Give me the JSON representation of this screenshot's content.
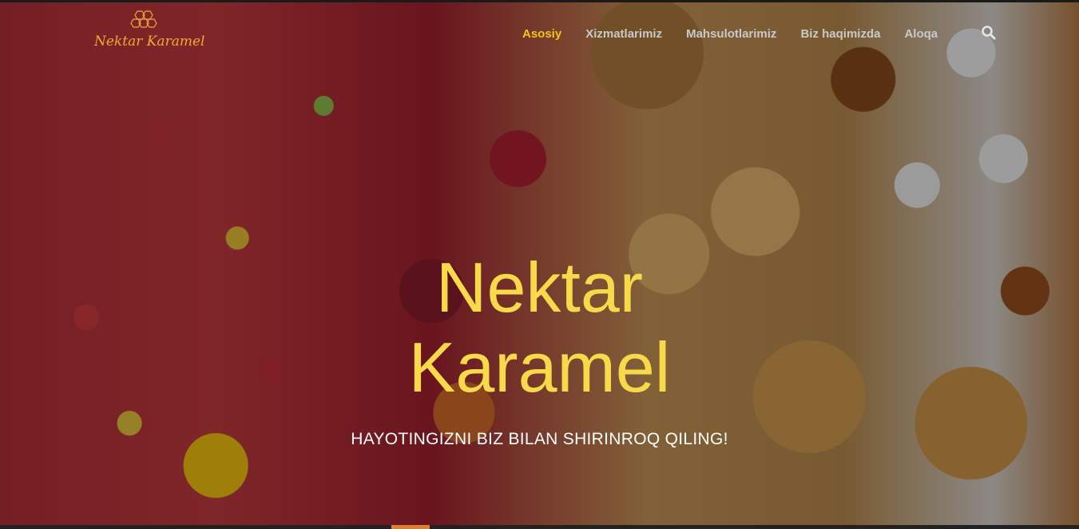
{
  "brand": {
    "name": "Nektar Karamel"
  },
  "nav": {
    "items": [
      {
        "label": "Asosiy",
        "active": true
      },
      {
        "label": "Xizmatlarimiz",
        "active": false
      },
      {
        "label": "Mahsulotlarimiz",
        "active": false
      },
      {
        "label": "Biz haqimizda",
        "active": false
      },
      {
        "label": "Aloqa",
        "active": false
      }
    ],
    "search_icon": "search-icon"
  },
  "hero": {
    "title_line1": "Nektar",
    "title_line2": "Karamel",
    "tagline": "HAYOTINGIZNI BIZ BILAN SHIRINROQ QILING!"
  },
  "colors": {
    "accent": "#f5c518",
    "title": "#f8d94a",
    "logo": "#f0a838"
  }
}
